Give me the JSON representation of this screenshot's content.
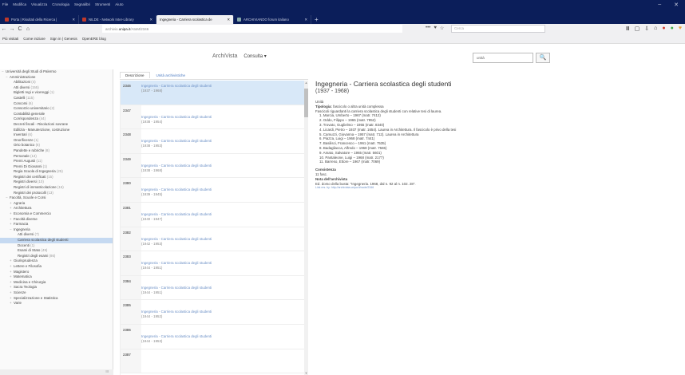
{
  "browser": {
    "menu": [
      "File",
      "Modifica",
      "Visualizza",
      "Cronologia",
      "Segnalibri",
      "Strumenti",
      "Aiuto"
    ],
    "window_controls": [
      "–",
      "✕"
    ],
    "tabs": [
      {
        "label": "Porta | Risultati della Ricerca |"
      },
      {
        "label": "NILDE - Network Inter-Library"
      },
      {
        "label": "Ingegneria - Carriera scolastica de",
        "active": true
      },
      {
        "label": "ARCHIVIANDO forum italiano"
      }
    ],
    "new_tab": "+",
    "nav_icons": [
      "←",
      "→",
      "C",
      "⌂"
    ],
    "url_prefix": "archivio.",
    "url_domain": "unipa.it",
    "url_suffix": "/AtoM/2346",
    "url_icons": [
      "•••",
      "♥",
      "☆"
    ],
    "search_placeholder": "Cerca",
    "toolbar_icons": [
      "Ⅲ",
      "▢",
      "⇩",
      "⌂",
      "●",
      "●",
      "♥"
    ],
    "bookmarks": [
      "Più visitati",
      "Come iniziare",
      "Sign in | Genesis",
      "OpenERE blog"
    ]
  },
  "app": {
    "brand": "ArchiVista",
    "nav_consulta": "Consulta ▾",
    "search_query": "unità",
    "search_button": "🔍"
  },
  "tree": [
    {
      "label": "Università degli Studi di Palermo",
      "count": "",
      "depth": 0,
      "toggle": "−"
    },
    {
      "label": "Amministrazione",
      "count": "",
      "depth": 1,
      "toggle": "−"
    },
    {
      "label": "Abilitazioni",
      "count": "(4)",
      "depth": 2,
      "toggle": ""
    },
    {
      "label": "Atti diversi",
      "count": "(155)",
      "depth": 2,
      "toggle": ""
    },
    {
      "label": "Bigletti regi e vicereggi",
      "count": "(1)",
      "depth": 2,
      "toggle": ""
    },
    {
      "label": "Castelli",
      "count": "(115)",
      "depth": 2,
      "toggle": ""
    },
    {
      "label": "Concorsi",
      "count": "(6)",
      "depth": 2,
      "toggle": ""
    },
    {
      "label": "Consorzio universitario",
      "count": "(2)",
      "depth": 2,
      "toggle": ""
    },
    {
      "label": "Contabilità generale",
      "count": "",
      "depth": 2,
      "toggle": ""
    },
    {
      "label": "Corrispondenza",
      "count": "(44)",
      "depth": 2,
      "toggle": ""
    },
    {
      "label": "Decreti fiscali - Risoluzioni sovrane",
      "count": "",
      "depth": 2,
      "toggle": ""
    },
    {
      "label": "Edilizia - Manutenzione, costruzione",
      "count": "",
      "depth": 2,
      "toggle": ""
    },
    {
      "label": "Inventari",
      "count": "(6)",
      "depth": 2,
      "toggle": ""
    },
    {
      "label": "Onorificenze",
      "count": "(1)",
      "depth": 2,
      "toggle": ""
    },
    {
      "label": "Orto botanico",
      "count": "(6)",
      "depth": 2,
      "toggle": ""
    },
    {
      "label": "Pandette e rubriche",
      "count": "(8)",
      "depth": 2,
      "toggle": ""
    },
    {
      "label": "Personale",
      "count": "(13)",
      "depth": 2,
      "toggle": ""
    },
    {
      "label": "Premi Augusti",
      "count": "(11)",
      "depth": 2,
      "toggle": ""
    },
    {
      "label": "Premi Di Giovanni",
      "count": "(1)",
      "depth": 2,
      "toggle": ""
    },
    {
      "label": "Regia Scuola di Ingegneria",
      "count": "(25)",
      "depth": 2,
      "toggle": ""
    },
    {
      "label": "Registri dei certificati",
      "count": "(15)",
      "depth": 2,
      "toggle": ""
    },
    {
      "label": "Registri diversi",
      "count": "(10)",
      "depth": 2,
      "toggle": ""
    },
    {
      "label": "Registri di immatricolazione",
      "count": "(16)",
      "depth": 2,
      "toggle": ""
    },
    {
      "label": "Registri dei protocolli",
      "count": "(13)",
      "depth": 2,
      "toggle": ""
    },
    {
      "label": "Facoltà, Scuole e Corsi",
      "count": "",
      "depth": 1,
      "toggle": "−"
    },
    {
      "label": "Agraria",
      "count": "",
      "depth": 2,
      "toggle": "+"
    },
    {
      "label": "Architettura",
      "count": "",
      "depth": 2,
      "toggle": "+"
    },
    {
      "label": "Economia e Commercio",
      "count": "",
      "depth": 2,
      "toggle": "+"
    },
    {
      "label": "Facoltà diverse",
      "count": "",
      "depth": 2,
      "toggle": "+"
    },
    {
      "label": "Farmacia",
      "count": "",
      "depth": 2,
      "toggle": "+"
    },
    {
      "label": "Ingegneria",
      "count": "",
      "depth": 2,
      "toggle": "−"
    },
    {
      "label": "Atti diversi",
      "count": "(7)",
      "depth": 3,
      "toggle": ""
    },
    {
      "label": "Carriera scolastica degli studenti",
      "count": "",
      "depth": 3,
      "toggle": "",
      "selected": true
    },
    {
      "label": "Docenti",
      "count": "(1)",
      "depth": 3,
      "toggle": ""
    },
    {
      "label": "Esami di Stato",
      "count": "(49)",
      "depth": 3,
      "toggle": ""
    },
    {
      "label": "Registri degli esami",
      "count": "(86)",
      "depth": 3,
      "toggle": ""
    },
    {
      "label": "Giurisprudenza",
      "count": "",
      "depth": 2,
      "toggle": "+"
    },
    {
      "label": "Lettere e Filosofia",
      "count": "",
      "depth": 2,
      "toggle": "+"
    },
    {
      "label": "Magistero",
      "count": "",
      "depth": 2,
      "toggle": "+"
    },
    {
      "label": "Matematica",
      "count": "",
      "depth": 2,
      "toggle": "+"
    },
    {
      "label": "Medicina e Chirurgia",
      "count": "",
      "depth": 2,
      "toggle": "+"
    },
    {
      "label": "Sacra Teologia",
      "count": "",
      "depth": 2,
      "toggle": "+"
    },
    {
      "label": "Scienze",
      "count": "",
      "depth": 2,
      "toggle": "+"
    },
    {
      "label": "Specializzazione e Statistica",
      "count": "",
      "depth": 2,
      "toggle": "+"
    },
    {
      "label": "Varie",
      "count": "",
      "depth": 2,
      "toggle": "+"
    }
  ],
  "tree_footer": "III",
  "mid_tabs": {
    "description": "Descrizione",
    "archive_units": "Unità archivistiche"
  },
  "units": [
    {
      "num": "2346",
      "title": "Ingegneria - Carriera scolastica degli studenti",
      "years": "(1937 - 1968)",
      "selected": true
    },
    {
      "num": "2347",
      "title": "Ingegneria - Carriera scolastica degli studenti",
      "years": "(1938 - 1954)"
    },
    {
      "num": "2348",
      "title": "Ingegneria - Carriera scolastica degli studenti",
      "years": "(1938 - 1953)"
    },
    {
      "num": "2349",
      "title": "Ingegneria - Carriera scolastica degli studenti",
      "years": "(1938 - 1968)"
    },
    {
      "num": "2380",
      "title": "Ingegneria - Carriera scolastica degli studenti",
      "years": "(1939 - 1945)"
    },
    {
      "num": "2381",
      "title": "Ingegneria - Carriera scolastica degli studenti",
      "years": "(1940 - 1947)"
    },
    {
      "num": "2382",
      "title": "Ingegneria - Carriera scolastica degli studenti",
      "years": "(1942 - 1953)"
    },
    {
      "num": "2383",
      "title": "Ingegneria - Carriera scolastica degli studenti",
      "years": "(1944 - 1951)"
    },
    {
      "num": "2384",
      "title": "Ingegneria - Carriera scolastica degli studenti",
      "years": "(1944 - 1951)"
    },
    {
      "num": "2385",
      "title": "Ingegneria - Carriera scolastica degli studenti",
      "years": "(1944 - 1952)"
    },
    {
      "num": "2386",
      "title": "Ingegneria - Carriera scolastica degli studenti",
      "years": "(1944 - 1953)"
    },
    {
      "num": "2387",
      "title": "",
      "years": ""
    }
  ],
  "detail": {
    "title": "Ingegneria - Carriera scolastica degli studenti",
    "range": "(1937 - 1968)",
    "unit_label": "Unità",
    "tipologia_label": "Tipologia:",
    "tipologia": "fascicolo o altra unità complessa",
    "content": "Fascicoli riguardanti la carriera scolastica degli studenti con relative tesi di laurea.",
    "entries": [
      "1. Marcia, Umberto – 1967 (matr. 7412)",
      "2. Oddo, Filippo – 1965 (matr. 7952)",
      "3. Trovato, Guglielmo – 1955 (matr. 8340)",
      "4. Licardi, Pietro – 1937 (matr. 1654). Laurea in Architettura. Il fascicolo è privo della tesi",
      "5. Camuzzi, Giovanna – 1957 (matr. 712). Laurea in Architettura",
      "6. Piazza, Luigi – 1968 (matr. 7441)",
      "7. Basilisci, Francesco – 1961 (matr. 7535)",
      "8. Badagliacca, Alfredo – 1968 (matr. 7565)",
      "9. Amato, Salvatore – 1965 (matr. 5601)",
      "10. Pantaleone, Luigi – 1968 (matr. 2177)",
      "11. Barreso, Ettore – 1967 (matr. 7069)"
    ],
    "consistenza_label": "Consistenza",
    "consistenza": "11 fasc.",
    "note_label": "Nota dell'archivista",
    "note": "Ed. dorso della busta: \"Ingegneria. 1968, dal n. 92 al n. 102. 28\".",
    "link": "Link res. by: http://archivista.unipa.it/node/2346"
  }
}
